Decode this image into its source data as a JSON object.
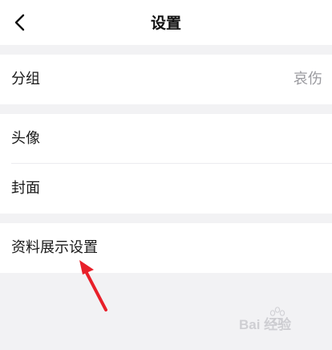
{
  "header": {
    "title": "设置",
    "back_icon": "chevron-left-icon"
  },
  "groups": [
    {
      "items": [
        {
          "label": "分组",
          "value": "哀伤"
        }
      ]
    },
    {
      "items": [
        {
          "label": "头像"
        },
        {
          "label": "封面"
        }
      ]
    },
    {
      "items": [
        {
          "label": "资料展示设置"
        }
      ]
    }
  ],
  "annotation": {
    "arrow_color": "#e8202a"
  },
  "watermark": {
    "text": "Bai 经验"
  },
  "colors": {
    "background": "#f2f2f4",
    "card": "#ffffff",
    "secondary_text": "#9a9a9f"
  }
}
